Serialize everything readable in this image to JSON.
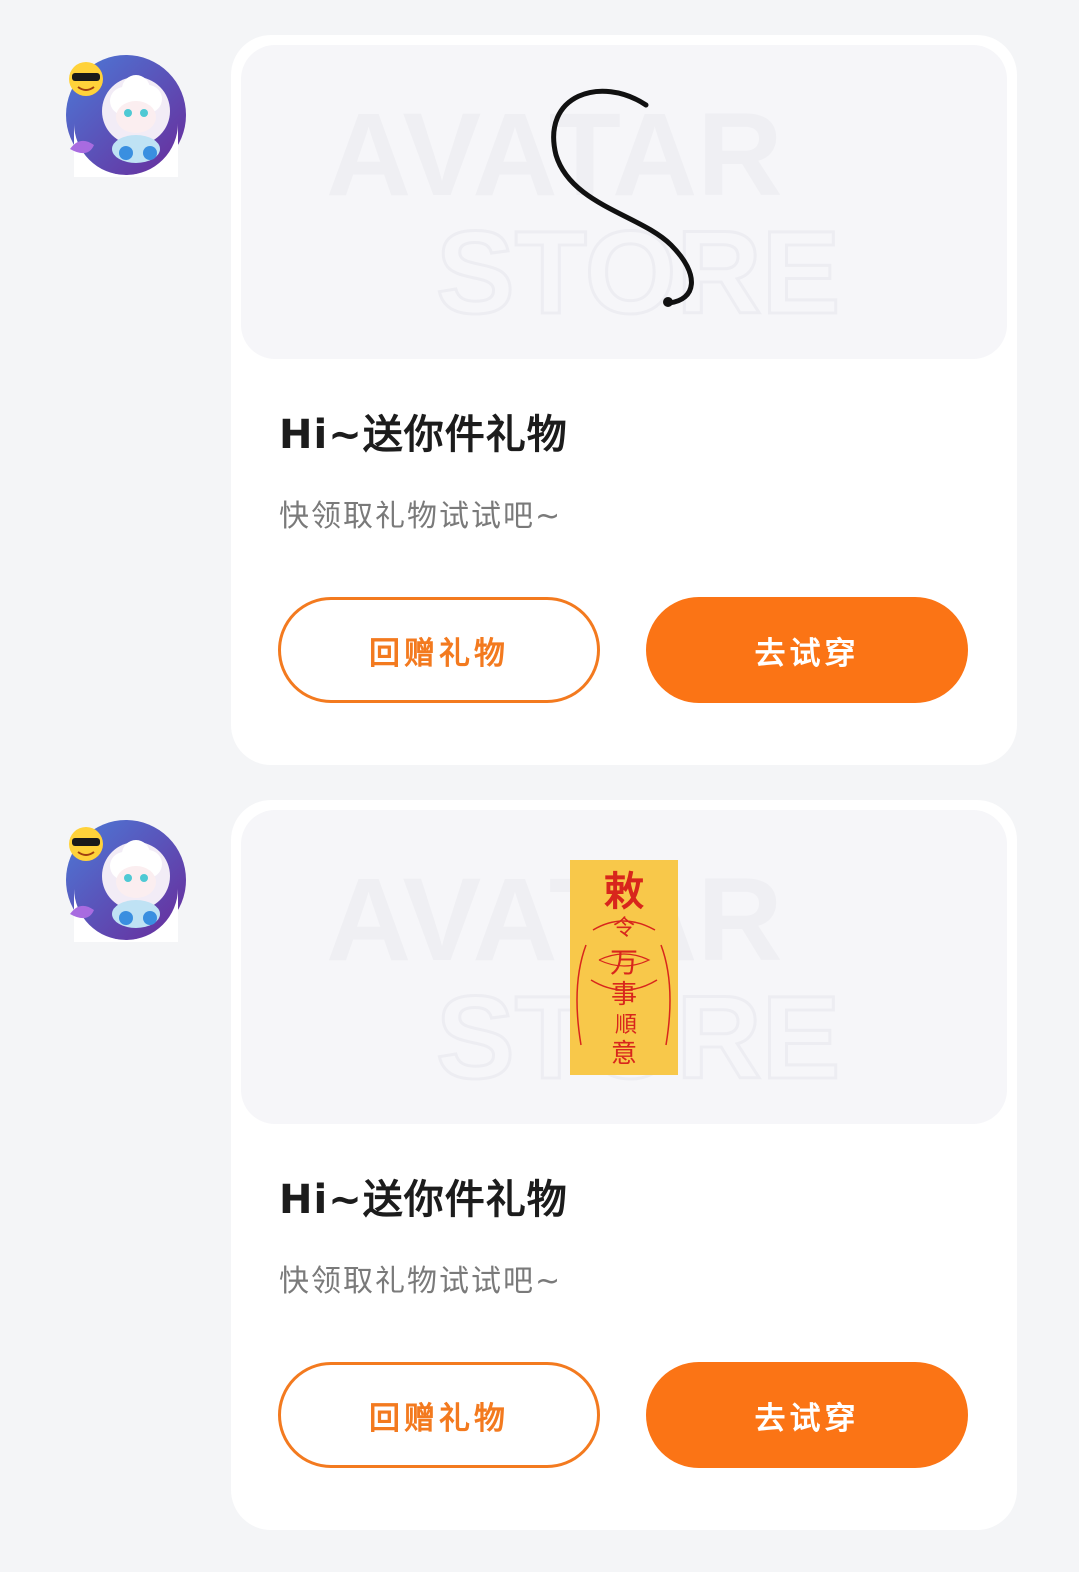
{
  "messages": [
    {
      "title": "Hi~送你件礼物",
      "subtitle": "快领取礼物试试吧~",
      "gift_image": "black-curly-tail-icon",
      "watermark_line1": "AVATAR",
      "watermark_line2": "STORE",
      "return_gift_label": "回赠礼物",
      "try_on_label": "去试穿"
    },
    {
      "title": "Hi~送你件礼物",
      "subtitle": "快领取礼物试试吧~",
      "gift_image": "yellow-talisman-icon",
      "talisman_chars": [
        "敕",
        "令",
        "万",
        "事",
        "順",
        "意"
      ],
      "watermark_line1": "AVATAR",
      "watermark_line2": "STORE",
      "return_gift_label": "回赠礼物",
      "try_on_label": "去试穿"
    }
  ],
  "colors": {
    "accent": "#fb7415",
    "outline": "#f37a1f",
    "page_bg": "#f4f5f7",
    "talisman_bg": "#f8c84a",
    "talisman_ink": "#d8261c"
  }
}
